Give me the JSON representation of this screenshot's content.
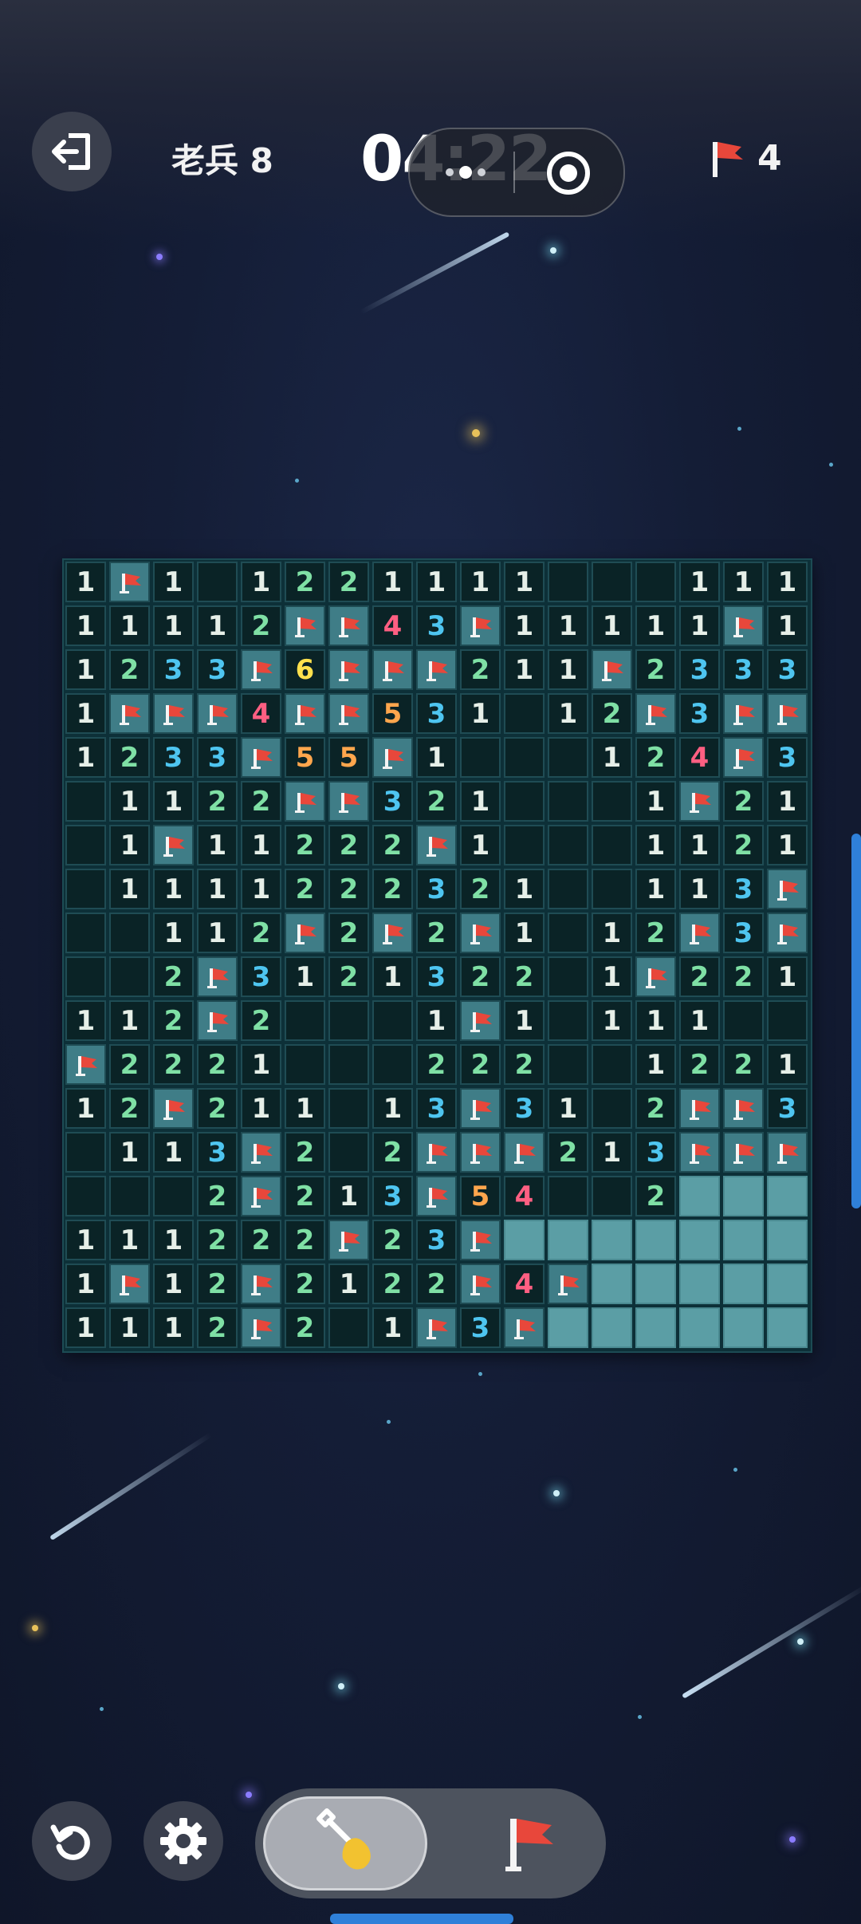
{
  "header": {
    "level_label": "老兵 8",
    "timer": "04:22",
    "flags_remaining": "4"
  },
  "icons": {
    "exit": "exit-icon",
    "record": "record-icon",
    "flag": "flag-icon",
    "undo": "undo-icon",
    "settings": "gear-icon",
    "dig": "shovel-icon",
    "flag_mode": "flag-icon"
  },
  "colors": {
    "n1": "#e6efe8",
    "n2": "#7fe0a5",
    "n3": "#4ec5f0",
    "n4": "#ff5f82",
    "n5": "#ffa64d",
    "n6": "#ffe14d",
    "flag": "#e8473b"
  },
  "board": {
    "rows": 18,
    "cols": 17,
    "legend": "digit=count, F=flag, .=empty, #=unopened",
    "grid": [
      "1F1.1221111...111",
      "11112FF43F11111F1",
      "1233F6FFF211F2333",
      "1FFF4FF531.12F3FF",
      "1233F55F1...124F3",
      ".1122FF321...1F21",
      ".1F11222F1...1121",
      ".1111222321..113F",
      "..112F2F2F1.12F3F",
      "..2F3121322.1F221",
      "112F2...1F1.111..",
      "F2221...222..1221",
      "12F211.13F31.2FF3",
      ".113F2.2FFF213FFF",
      "...2F213F54..2###",
      "1112221F23F######",
      "1F12F2122F4F#####",
      "1112F2.1F3F######"
    ]
  },
  "board_fix": {
    "row15": "111222F23F#######"
  }
}
